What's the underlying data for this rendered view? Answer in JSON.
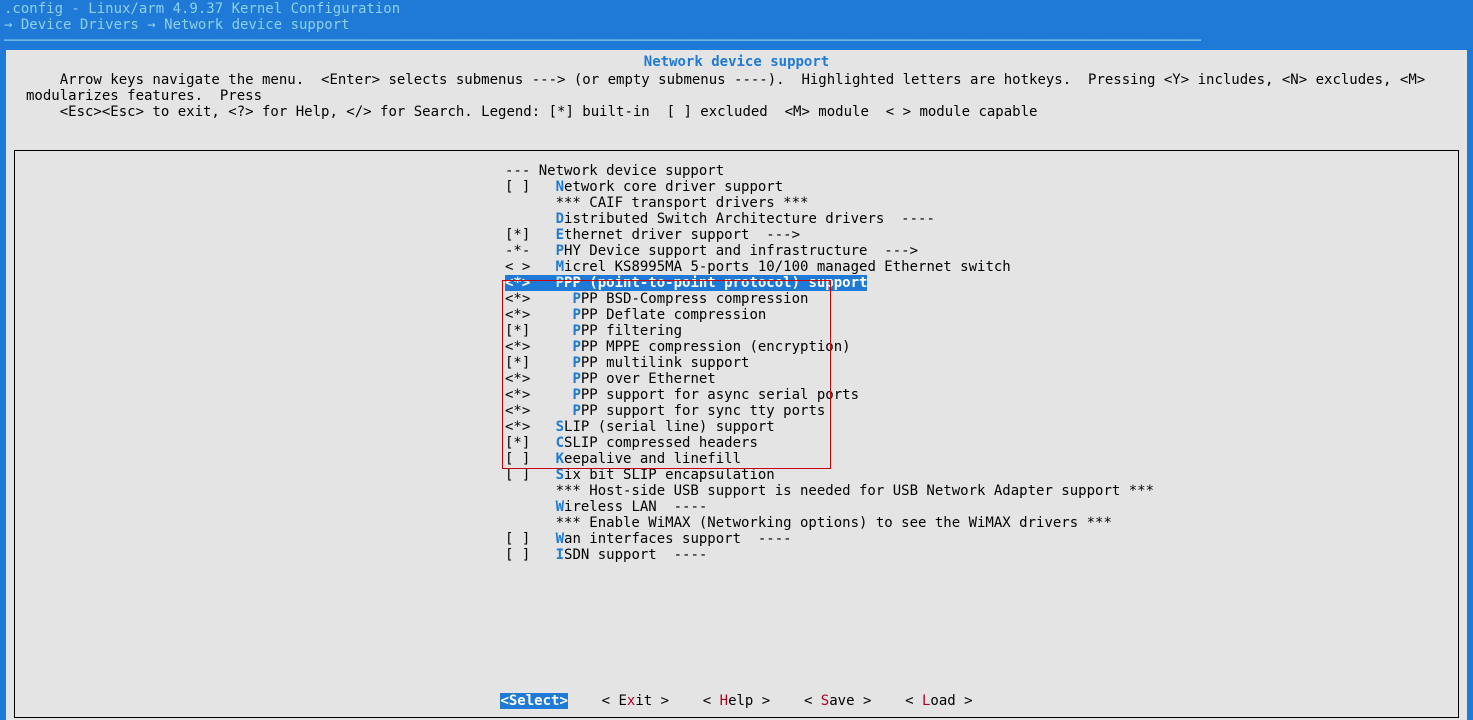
{
  "titlebar": {
    "line1": ".config - Linux/arm 4.9.37 Kernel Configuration",
    "line2": "→ Device Drivers → Network device support ──────────────────────────────────────────────────────────────────────────────────────────────────────────────────────────────────────────────"
  },
  "section_title": "Network device support",
  "help_text": "    Arrow keys navigate the menu.  <Enter> selects submenus ---> (or empty submenus ----).  Highlighted letters are hotkeys.  Pressing <Y> includes, <N> excludes, <M> modularizes features.  Press\n    <Esc><Esc> to exit, <?> for Help, </> for Search. Legend: [*] built-in  [ ] excluded  <M> module  < > module capable",
  "menu": [
    {
      "prefix": "---",
      "indent": 1,
      "hotkey": "",
      "label": "Network device support"
    },
    {
      "prefix": "[ ]",
      "indent": 3,
      "hotkey": "N",
      "label": "etwork core driver support"
    },
    {
      "prefix": "   ",
      "indent": 3,
      "hotkey": "",
      "label": "*** CAIF transport drivers ***"
    },
    {
      "prefix": "   ",
      "indent": 3,
      "hotkey": "D",
      "label": "istributed Switch Architecture drivers  ----"
    },
    {
      "prefix": "[*]",
      "indent": 3,
      "hotkey": "E",
      "label": "thernet driver support  --->"
    },
    {
      "prefix": "-*-",
      "indent": 3,
      "hotkey": "P",
      "label": "HY Device support and infrastructure  --->"
    },
    {
      "prefix": "< >",
      "indent": 3,
      "hotkey": "M",
      "label": "icrel KS8995MA 5-ports 10/100 managed Ethernet switch"
    },
    {
      "prefix": "<*>",
      "indent": 3,
      "hotkey": "P",
      "label": "PP (point-to-point protocol) support",
      "selected": true
    },
    {
      "prefix": "<*>",
      "indent": 5,
      "hotkey": "P",
      "label": "PP BSD-Compress compression"
    },
    {
      "prefix": "<*>",
      "indent": 5,
      "hotkey": "P",
      "label": "PP Deflate compression"
    },
    {
      "prefix": "[*]",
      "indent": 5,
      "hotkey": "P",
      "label": "PP filtering"
    },
    {
      "prefix": "<*>",
      "indent": 5,
      "hotkey": "P",
      "label": "PP MPPE compression (encryption)"
    },
    {
      "prefix": "[*]",
      "indent": 5,
      "hotkey": "P",
      "label": "PP multilink support"
    },
    {
      "prefix": "<*>",
      "indent": 5,
      "hotkey": "P",
      "label": "PP over Ethernet"
    },
    {
      "prefix": "<*>",
      "indent": 5,
      "hotkey": "P",
      "label": "PP support for async serial ports"
    },
    {
      "prefix": "<*>",
      "indent": 5,
      "hotkey": "P",
      "label": "PP support for sync tty ports"
    },
    {
      "prefix": "<*>",
      "indent": 3,
      "hotkey": "S",
      "label": "LIP (serial line) support"
    },
    {
      "prefix": "[*]",
      "indent": 3,
      "hotkey": "C",
      "label": "SLIP compressed headers"
    },
    {
      "prefix": "[ ]",
      "indent": 3,
      "hotkey": "K",
      "label": "eepalive and linefill"
    },
    {
      "prefix": "[ ]",
      "indent": 3,
      "hotkey": "S",
      "label": "ix bit SLIP encapsulation"
    },
    {
      "prefix": "   ",
      "indent": 3,
      "hotkey": "",
      "label": "*** Host-side USB support is needed for USB Network Adapter support ***"
    },
    {
      "prefix": "   ",
      "indent": 3,
      "hotkey": "W",
      "label": "ireless LAN  ----"
    },
    {
      "prefix": "   ",
      "indent": 3,
      "hotkey": "",
      "label": "*** Enable WiMAX (Networking options) to see the WiMAX drivers ***"
    },
    {
      "prefix": "[ ]",
      "indent": 3,
      "hotkey": "W",
      "label": "an interfaces support  ----"
    },
    {
      "prefix": "[ ]",
      "indent": 3,
      "hotkey": "I",
      "label": "SDN support  ----"
    }
  ],
  "buttons": {
    "select": "<Select>",
    "exit_pre": "< E",
    "exit_hot": "x",
    "exit_post": "it >",
    "help_pre": "< ",
    "help_hot": "H",
    "help_post": "elp >",
    "save_pre": "< ",
    "save_hot": "S",
    "save_post": "ave >",
    "load_pre": "< ",
    "load_hot": "L",
    "load_post": "oad >"
  }
}
